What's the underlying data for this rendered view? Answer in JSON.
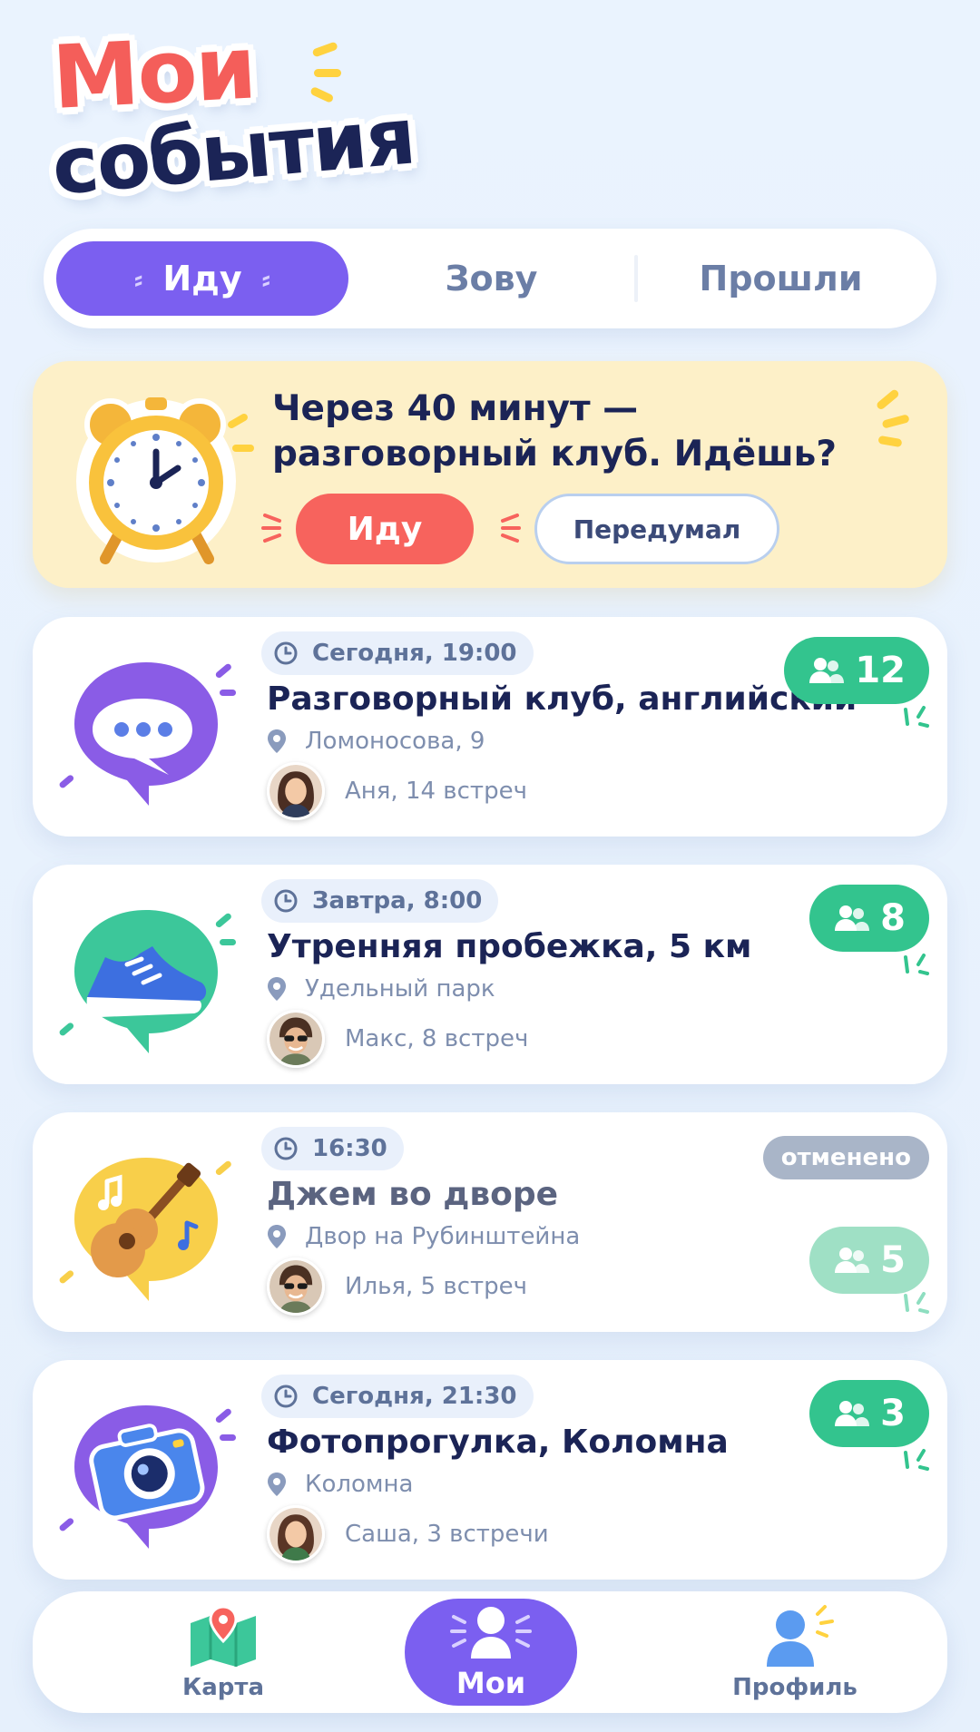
{
  "header": {
    "title_line1": "Мои",
    "title_line2": "события"
  },
  "tabs": [
    {
      "label": "Иду",
      "active": true
    },
    {
      "label": "Зову",
      "active": false
    },
    {
      "label": "Прошли",
      "active": false
    }
  ],
  "reminder": {
    "line1": "Через 40 минут —",
    "line2": "разговорный клуб. Идёшь?",
    "go_label": "Иду",
    "changed_label": "Передумал"
  },
  "events": [
    {
      "time": "Сегодня, 19:00",
      "title": "Разговорный клуб, английский",
      "place": "Ломоносова, 9",
      "host": "Аня, 14 встреч",
      "count": "12",
      "icon": "chat-bubble-icon"
    },
    {
      "time": "Завтра, 8:00",
      "title": "Утренняя пробежка, 5 км",
      "place": "Удельный парк",
      "host": "Макс, 8 встреч",
      "count": "8",
      "icon": "sneaker-icon"
    },
    {
      "time": "16:30",
      "title": "Джем во дворе",
      "place": "Двор на Рубинштейна",
      "host": "Илья, 5 встреч",
      "count": "5",
      "icon": "guitar-icon",
      "status": "отменено"
    },
    {
      "time": "Сегодня, 21:30",
      "title": "Фотопрогулка, Коломна",
      "place": "Коломна",
      "host": "Саша, 3 встречи",
      "count": "3",
      "icon": "camera-icon"
    }
  ],
  "nav": [
    {
      "label": "Карта",
      "icon": "map-icon"
    },
    {
      "label": "Мои",
      "icon": "person-icon",
      "active": true
    },
    {
      "label": "Профиль",
      "icon": "profile-icon"
    }
  ],
  "colors": {
    "accent": "#7b5ff0",
    "coral": "#f7635d",
    "green": "#33c48e",
    "navy": "#1b2456",
    "reminder_bg": "#fdf0c8"
  }
}
